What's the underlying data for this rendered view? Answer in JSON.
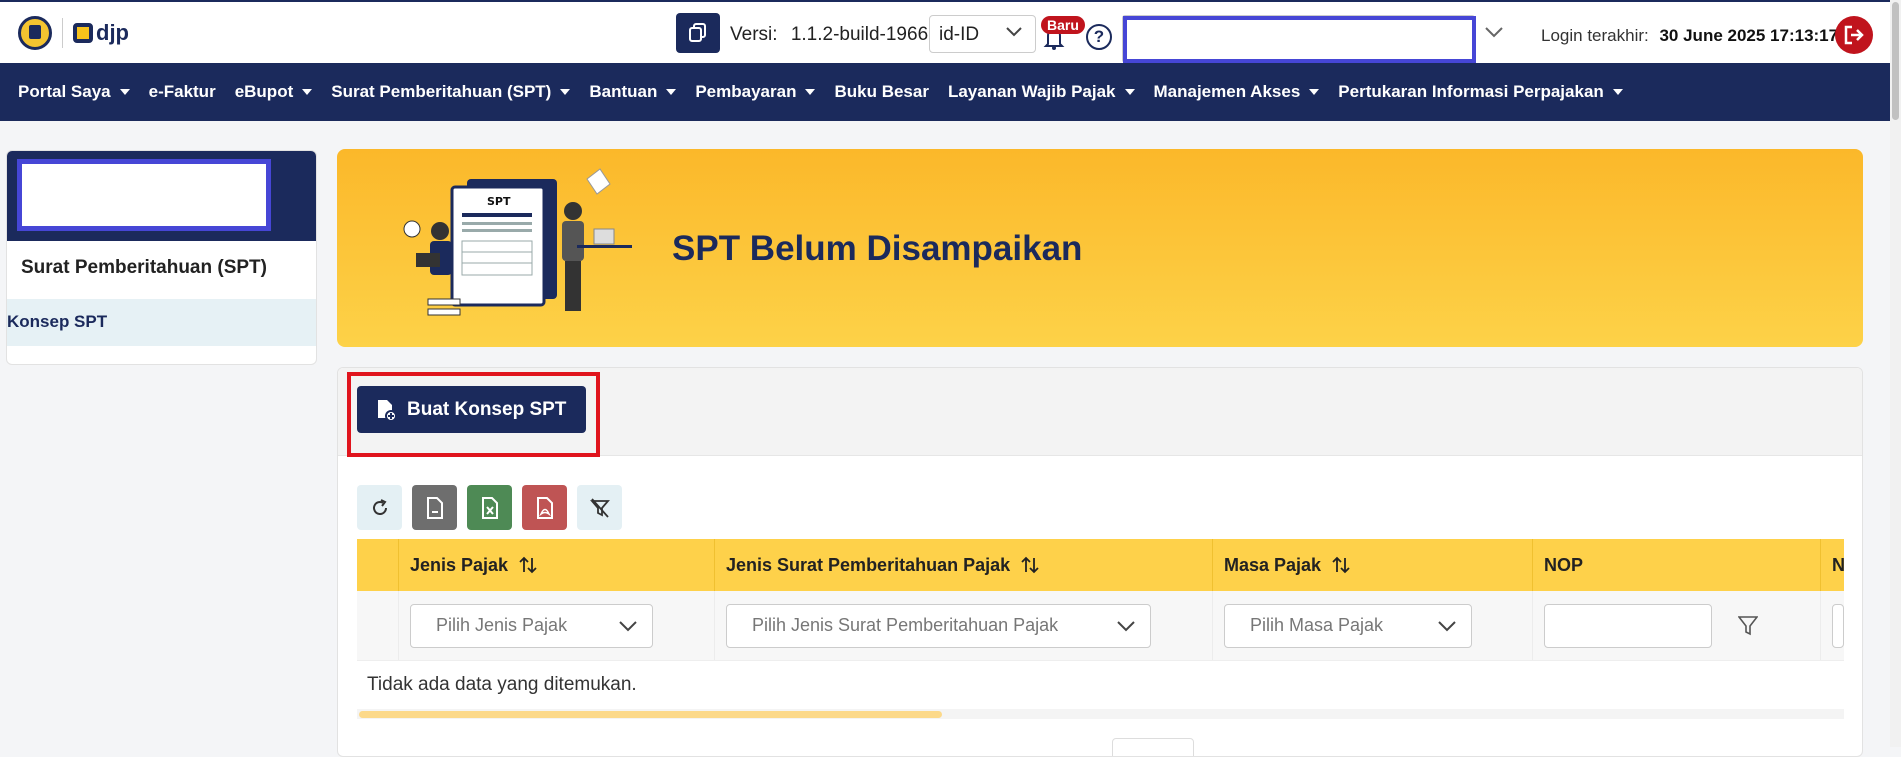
{
  "header": {
    "brand": "djp",
    "version_label": "Versi:",
    "version_value": "1.1.2-build-1966",
    "language": "id-ID",
    "notification_badge": "Baru",
    "help_glyph": "?",
    "login_label": "Login terakhir:",
    "login_value": "30 June 2025 17:13:17"
  },
  "nav": {
    "items": [
      {
        "label": "Portal Saya",
        "dropdown": true
      },
      {
        "label": "e-Faktur",
        "dropdown": false
      },
      {
        "label": "eBupot",
        "dropdown": true
      },
      {
        "label": "Surat Pemberitahuan (SPT)",
        "dropdown": true
      },
      {
        "label": "Bantuan",
        "dropdown": true
      },
      {
        "label": "Pembayaran",
        "dropdown": true
      },
      {
        "label": "Buku Besar",
        "dropdown": false
      },
      {
        "label": "Layanan Wajib Pajak",
        "dropdown": true
      },
      {
        "label": "Manajemen Akses",
        "dropdown": true
      },
      {
        "label": "Pertukaran Informasi Perpajakan",
        "dropdown": true
      }
    ]
  },
  "sidebar": {
    "title": "Surat Pemberitahuan (SPT)",
    "items": [
      {
        "label": "Konsep SPT",
        "active": true
      }
    ]
  },
  "banner": {
    "illustration_label": "SPT",
    "title": "SPT Belum Disampaikan"
  },
  "main": {
    "create_button": "Buat Konsep SPT",
    "toolbar": [
      "refresh-icon",
      "file-icon",
      "excel-icon",
      "pdf-icon",
      "filter-clear-icon"
    ],
    "columns": [
      "Jenis Pajak",
      "Jenis Surat Pemberitahuan Pajak",
      "Masa Pajak",
      "NOP",
      "N"
    ],
    "filters": {
      "jenis_pajak_placeholder": "Pilih Jenis Pajak",
      "jenis_spt_placeholder": "Pilih Jenis Surat Pemberitahuan Pajak",
      "masa_pajak_placeholder": "Pilih Masa Pajak"
    },
    "empty_message": "Tidak ada data yang ditemukan."
  },
  "colors": {
    "navy": "#1b2a5c",
    "banner_yellow": "#fbb82a",
    "header_yellow": "#fed14a",
    "danger": "#c0141d",
    "redaction_border": "#4646d6",
    "highlight_border": "#e0141d"
  }
}
